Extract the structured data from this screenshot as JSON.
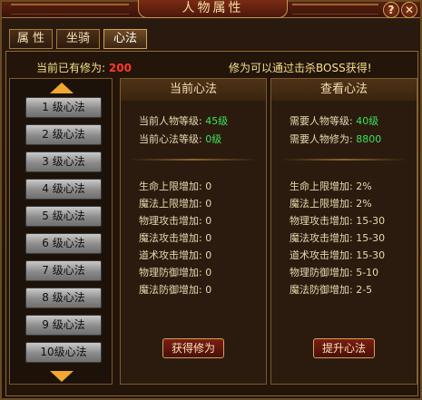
{
  "window": {
    "title": "人物属性"
  },
  "tabs": [
    {
      "label": "属 性",
      "active": false
    },
    {
      "label": "坐骑",
      "active": false
    },
    {
      "label": "心法",
      "active": true
    }
  ],
  "cultivation": {
    "label": "当前已有修为:",
    "value": "200",
    "hint": "修为可以通过击杀BOSS获得!"
  },
  "levels": [
    "1 级心法",
    "2 级心法",
    "3 级心法",
    "4 级心法",
    "5 级心法",
    "6 级心法",
    "7 级心法",
    "8 级心法",
    "9 级心法",
    "10级心法"
  ],
  "current": {
    "header": "当前心法",
    "info": [
      {
        "label": "当前人物等级:",
        "value": "45级"
      },
      {
        "label": "当前心法等级:",
        "value": "0级"
      }
    ],
    "stats": [
      {
        "label": "生命上限增加:",
        "value": "0"
      },
      {
        "label": "魔法上限增加:",
        "value": "0"
      },
      {
        "label": "物理攻击增加:",
        "value": "0"
      },
      {
        "label": "魔法攻击增加:",
        "value": "0"
      },
      {
        "label": "道术攻击增加:",
        "value": "0"
      },
      {
        "label": "物理防御增加:",
        "value": "0"
      },
      {
        "label": "魔法防御增加:",
        "value": "0"
      }
    ],
    "button": "获得修为"
  },
  "view": {
    "header": "查看心法",
    "info": [
      {
        "label": "需要人物等级:",
        "value": "40级"
      },
      {
        "label": "需要人物修为:",
        "value": "8800"
      }
    ],
    "stats": [
      {
        "label": "生命上限增加:",
        "value": "2%"
      },
      {
        "label": "魔法上限增加:",
        "value": "2%"
      },
      {
        "label": "物理攻击增加:",
        "value": "15-30"
      },
      {
        "label": "魔法攻击增加:",
        "value": "15-30"
      },
      {
        "label": "道术攻击增加:",
        "value": "15-30"
      },
      {
        "label": "物理防御增加:",
        "value": "5-10"
      },
      {
        "label": "魔法防御增加:",
        "value": "2-5"
      }
    ],
    "button": "提升心法"
  },
  "icons": {
    "help": "question-icon",
    "close": "close-icon",
    "scroll_up": "arrow-up-icon",
    "scroll_down": "arrow-down-icon"
  },
  "controls": {
    "help_glyph": "?",
    "close_glyph": "✕"
  }
}
